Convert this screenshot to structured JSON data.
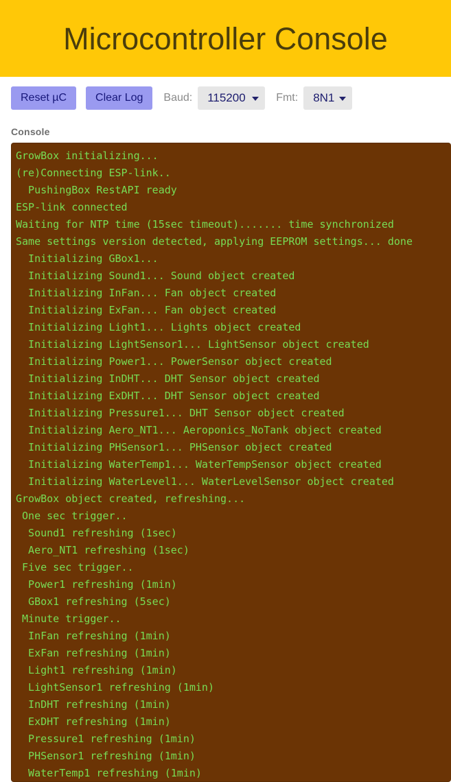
{
  "header": {
    "title": "Microcontroller Console",
    "background_color": "#FFC807",
    "title_color": "#4a3d0c"
  },
  "toolbar": {
    "reset_button_label": "Reset µC",
    "clear_button_label": "Clear Log",
    "baud_label": "Baud:",
    "baud_value": "115200",
    "baud_options": [
      "115200"
    ],
    "fmt_label": "Fmt:",
    "fmt_value": "8N1",
    "fmt_options": [
      "8N1"
    ],
    "button_color": "#9a9af0",
    "button_text_color": "#17177a",
    "select_color": "#e6e6e6",
    "select_text_color": "#1c1c6e"
  },
  "console": {
    "section_label": "Console",
    "background_color": "#6b3405",
    "text_color": "#77dd55",
    "lines": [
      "GrowBox initializing...",
      "(re)Connecting ESP-link..",
      "  PushingBox RestAPI ready",
      "ESP-link connected",
      "Waiting for NTP time (15sec timeout)....... time synchronized",
      "Same settings version detected, applying EEPROM settings... done",
      "  Initializing GBox1...",
      "  Initializing Sound1... Sound object created",
      "  Initializing InFan... Fan object created",
      "  Initializing ExFan... Fan object created",
      "  Initializing Light1... Lights object created",
      "  Initializing LightSensor1... LightSensor object created",
      "  Initializing Power1... PowerSensor object created",
      "  Initializing InDHT... DHT Sensor object created",
      "  Initializing ExDHT... DHT Sensor object created",
      "  Initializing Pressure1... DHT Sensor object created",
      "  Initializing Aero_NT1... Aeroponics_NoTank object created",
      "  Initializing PHSensor1... PHSensor object created",
      "  Initializing WaterTemp1... WaterTempSensor object created",
      "  Initializing WaterLevel1... WaterLevelSensor object created",
      "GrowBox object created, refreshing...",
      " One sec trigger..",
      "  Sound1 refreshing (1sec)",
      "  Aero_NT1 refreshing (1sec)",
      " Five sec trigger..",
      "  Power1 refreshing (1min)",
      "  GBox1 refreshing (5sec)",
      " Minute trigger..",
      "  InFan refreshing (1min)",
      "  ExFan refreshing (1min)",
      "  Light1 refreshing (1min)",
      "  LightSensor1 refreshing (1min)",
      "  InDHT refreshing (1min)",
      "  ExDHT refreshing (1min)",
      "  Pressure1 refreshing (1min)",
      "  PHSensor1 refreshing (1min)",
      "  WaterTemp1 refreshing (1min)"
    ]
  }
}
